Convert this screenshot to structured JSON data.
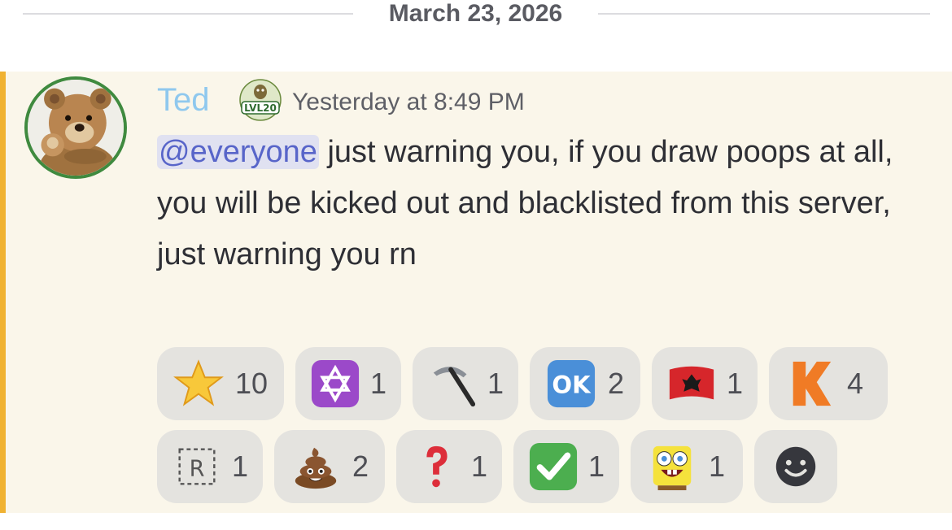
{
  "date_divider": "March 23, 2026",
  "message": {
    "author": "Ted",
    "author_color": "#8fc8ee",
    "highlight_color": "#f0b232",
    "role_badge_text": "LVL20",
    "timestamp": "Yesterday at 8:49 PM",
    "mention": "@everyone",
    "text": " just warning you, if you draw poops at all, you will be kicked out and blacklisted from this server, just warning you rn"
  },
  "reactions": {
    "row1": [
      {
        "icon": "star-emoji",
        "count": "10"
      },
      {
        "icon": "star-of-david-emoji",
        "count": "1"
      },
      {
        "icon": "pick-emoji",
        "count": "1"
      },
      {
        "icon": "ok-button-emoji",
        "count": "2"
      },
      {
        "icon": "albania-flag-emoji",
        "count": "1"
      },
      {
        "icon": "kofi-k-emoji",
        "count": "4"
      }
    ],
    "row2": [
      {
        "icon": "regional-r-emoji",
        "label": "R",
        "count": "1"
      },
      {
        "icon": "poop-emoji",
        "count": "2"
      },
      {
        "icon": "question-mark-emoji",
        "count": "1"
      },
      {
        "icon": "check-mark-emoji",
        "count": "1"
      },
      {
        "icon": "spongebob-emoji",
        "count": "1"
      },
      {
        "icon": "add-reaction-icon"
      }
    ],
    "ok_label": "OK"
  }
}
